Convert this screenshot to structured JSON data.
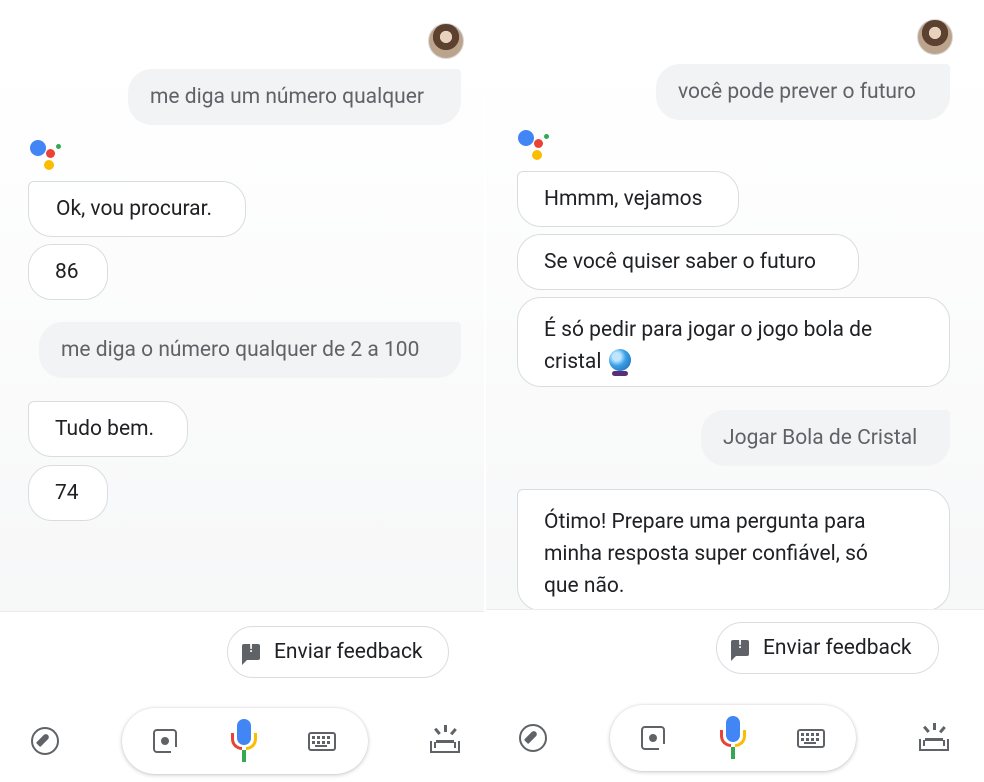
{
  "left": {
    "messages": [
      {
        "role": "user",
        "text": "me diga um número qualquer"
      },
      {
        "role": "assistant",
        "text": "Ok, vou procurar."
      },
      {
        "role": "assistant",
        "text": "86"
      },
      {
        "role": "user",
        "text": "me diga o número qualquer de 2 a 100"
      },
      {
        "role": "assistant",
        "text": "Tudo bem."
      },
      {
        "role": "assistant",
        "text": "74"
      }
    ],
    "feedback_label": "Enviar feedback"
  },
  "right": {
    "messages": [
      {
        "role": "user",
        "text": "você pode prever o futuro"
      },
      {
        "role": "assistant",
        "text": "Hmmm, vejamos"
      },
      {
        "role": "assistant",
        "text": "Se você quiser saber o futuro"
      },
      {
        "role": "assistant",
        "text": "É só pedir para jogar o jogo bola de cristal",
        "emoji": "crystal-ball-icon"
      },
      {
        "role": "user",
        "text": "Jogar Bola de Cristal"
      },
      {
        "role": "assistant",
        "text": "Ótimo! Prepare uma pergunta para minha resposta super confiável, só que não."
      }
    ],
    "feedback_label": "Enviar feedback"
  },
  "icons": {
    "explore": "compass-icon",
    "lens": "lens-icon",
    "mic": "mic-icon",
    "keyboard": "keyboard-icon",
    "updates": "updates-icon",
    "assistant_logo": "google-assistant-logo",
    "user_avatar": "user-avatar"
  },
  "colors": {
    "google_blue": "#4285f4",
    "google_red": "#ea4335",
    "google_yellow": "#fbbc04",
    "google_green": "#34a853",
    "user_bubble": "#f1f3f4",
    "user_text": "#5f6368",
    "assistant_border": "#dadce0"
  }
}
